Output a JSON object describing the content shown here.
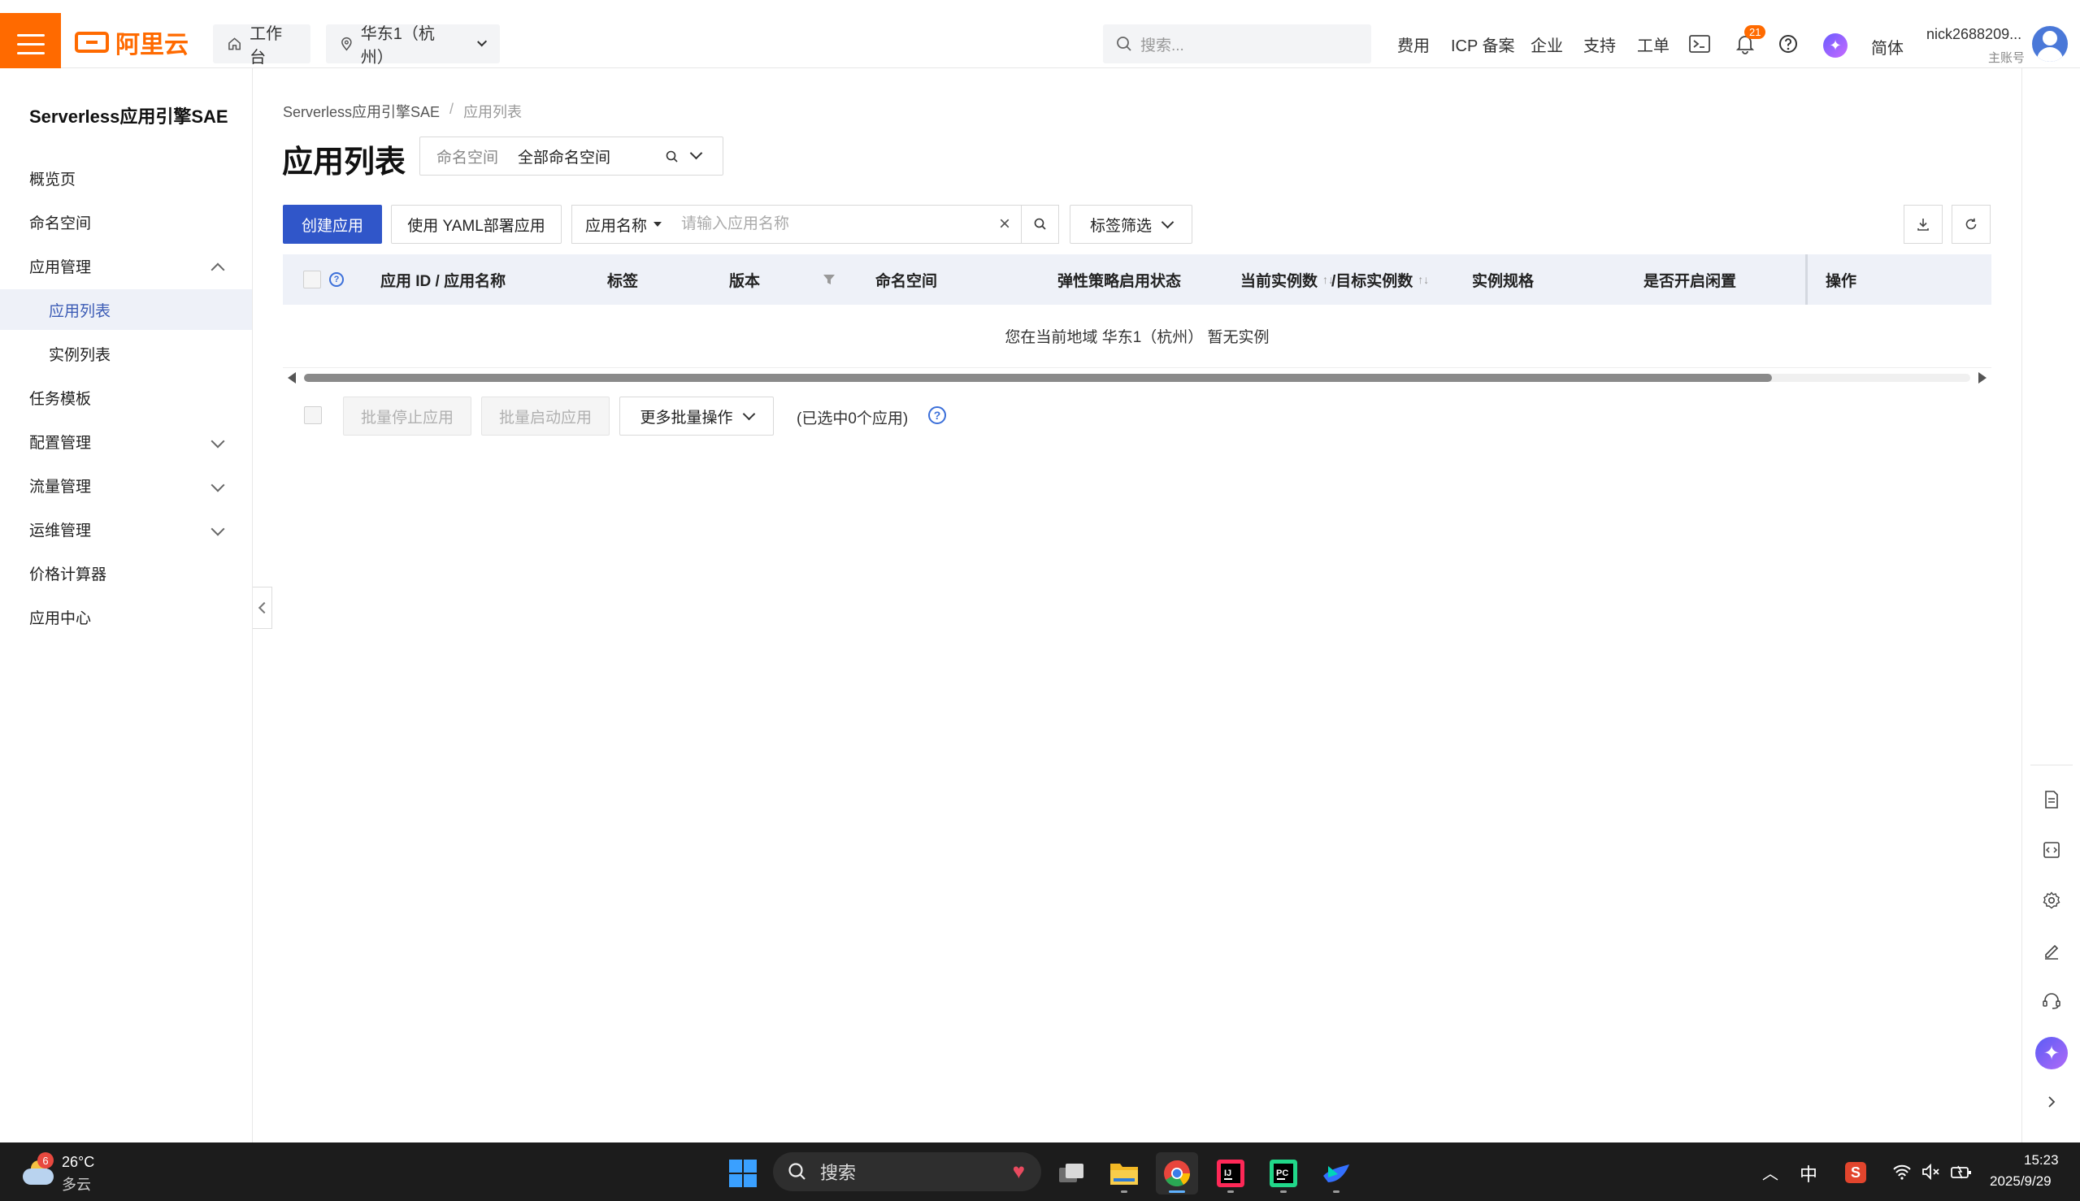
{
  "topbar": {
    "logo_text": "阿里云",
    "workbench": "工作台",
    "region": "华东1（杭州）",
    "search_placeholder": "搜索...",
    "links": [
      "费用",
      "ICP 备案",
      "企业",
      "支持",
      "工单"
    ],
    "notification_count": "21",
    "language": "简体",
    "user_name": "nick2688209...",
    "user_role": "主账号",
    "accent_color": "#ff6a00"
  },
  "sidebar": {
    "title": "Serverless应用引擎SAE",
    "items": [
      {
        "label": "概览页"
      },
      {
        "label": "命名空间"
      },
      {
        "label": "应用管理"
      },
      {
        "label": "应用列表"
      },
      {
        "label": "实例列表"
      },
      {
        "label": "任务模板"
      },
      {
        "label": "配置管理"
      },
      {
        "label": "流量管理"
      },
      {
        "label": "运维管理"
      },
      {
        "label": "价格计算器"
      },
      {
        "label": "应用中心"
      }
    ]
  },
  "main": {
    "breadcrumb": [
      "Serverless应用引擎SAE",
      "应用列表"
    ],
    "title": "应用列表",
    "namespace_label": "命名空间",
    "namespace_value": "全部命名空间",
    "create_button": "创建应用",
    "yaml_button": "使用 YAML部署应用",
    "search_field": "应用名称",
    "search_placeholder": "请输入应用名称",
    "tag_filter": "标签筛选",
    "columns": [
      "应用 ID / 应用名称",
      "标签",
      "版本",
      "命名空间",
      "弹性策略启用状态",
      "当前实例数",
      "/目标实例数",
      "实例规格",
      "是否开启闲置",
      "操作"
    ],
    "empty_text": "您在当前地域 华东1（杭州） 暂无实例",
    "batch_stop": "批量停止应用",
    "batch_start": "批量启动应用",
    "more_batch": "更多批量操作",
    "selected_count_text": "(已选中0个应用)",
    "primary_color": "#3056c9"
  },
  "taskbar": {
    "weather_temp": "26°C",
    "weather_desc": "多云",
    "weather_badge": "6",
    "search_label": "搜索",
    "ime": "中",
    "time": "15:23",
    "date": "2025/9/29"
  }
}
